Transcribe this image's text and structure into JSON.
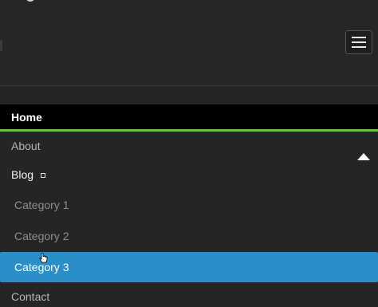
{
  "menu": {
    "items": [
      {
        "label": "Home"
      },
      {
        "label": "About"
      },
      {
        "label": "Blog"
      },
      {
        "label": "Category 1"
      },
      {
        "label": "Category 2"
      },
      {
        "label": "Category 3"
      },
      {
        "label": "Contact"
      }
    ],
    "active_item": "Home",
    "highlighted_item": "Category 3"
  },
  "icons": {
    "menu_toggle": "hamburger-icon",
    "submenu_collapse": "triangle-up-icon",
    "blog_toggle": "square-toggle-icon",
    "cursor": "hand-pointer-icon"
  },
  "colors": {
    "background": "#252525",
    "active_background": "#000000",
    "active_underline": "#6cc04a",
    "highlight": "#2a8fc8"
  }
}
